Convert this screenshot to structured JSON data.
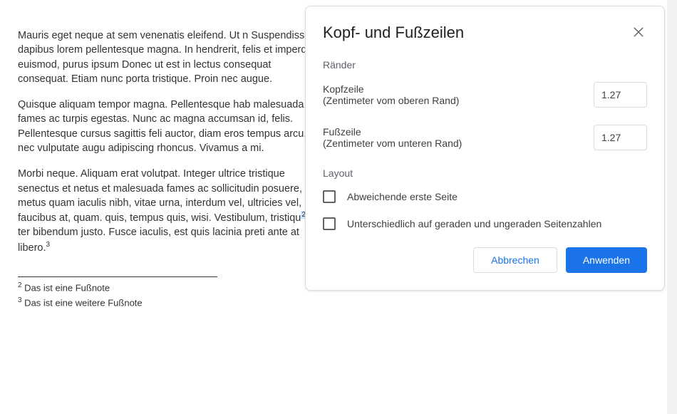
{
  "document": {
    "para1": "Mauris eget neque at sem venenatis eleifend. Ut n Suspendisse dapibus lorem pellentesque magna. In hendrerit, felis et imperdiet euismod, purus ipsum Donec ut est in lectus consequat consequat. Etiam nunc porta tristique. Proin nec augue.",
    "para2": "Quisque aliquam tempor magna. Pellentesque hab malesuada fames ac turpis egestas. Nunc ac magna accumsan id, felis. Pellentesque cursus sagittis feli auctor, diam eros tempus arcu, nec vulputate augu adipiscing rhoncus. Vivamus a mi.",
    "para3_before": "Morbi neque. Aliquam erat volutpat. Integer ultrice tristique senectus et netus et malesuada fames ac sollicitudin posuere, metus quam iaculis nibh, vitae urna, interdum vel, ultricies vel, faucibus at, quam. quis, tempus quis, wisi. Vestibulum, tristiqu",
    "para3_sup": "2",
    "para3_after": " ac, ter bibendum justo. Fusce iaculis, est quis lacinia preti ante at libero.",
    "para3_sup2": "3",
    "footnote1_num": "2",
    "footnote1_text": " Das ist eine Fußnote",
    "footnote2_num": "3",
    "footnote2_text": " Das ist eine weitere Fußnote"
  },
  "modal": {
    "title": "Kopf- und Fußzeilen",
    "margins_section": "Ränder",
    "header_label": "Kopfzeile",
    "header_sublabel": "(Zentimeter vom oberen Rand)",
    "header_value": "1.27",
    "footer_label": "Fußzeile",
    "footer_sublabel": "(Zentimeter vom unteren Rand)",
    "footer_value": "1.27",
    "layout_section": "Layout",
    "checkbox1_label": "Abweichende erste Seite",
    "checkbox2_label": "Unterschiedlich auf geraden und ungeraden Seitenzahlen",
    "cancel_button": "Abbrechen",
    "apply_button": "Anwenden"
  }
}
